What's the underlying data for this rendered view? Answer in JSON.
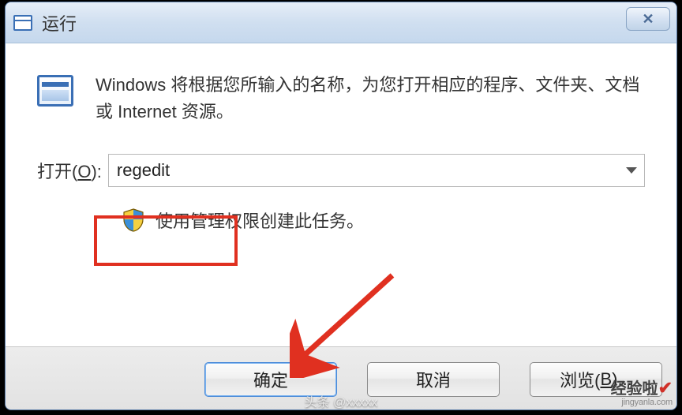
{
  "window": {
    "title": "运行"
  },
  "description": "Windows 将根据您所输入的名称，为您打开相应的程序、文件夹、文档或 Internet 资源。",
  "open": {
    "label_prefix": "打开(",
    "label_hotkey": "O",
    "label_suffix": "):",
    "value": "regedit"
  },
  "admin_note": "使用管理权限创建此任务。",
  "buttons": {
    "ok": "确定",
    "cancel": "取消",
    "browse_prefix": "浏览(",
    "browse_hotkey": "B",
    "browse_suffix": ")..."
  },
  "watermark": {
    "footer": "头条 @xxxxx",
    "logo_top": "经验啦",
    "logo_bottom": "jingyanla.com"
  }
}
